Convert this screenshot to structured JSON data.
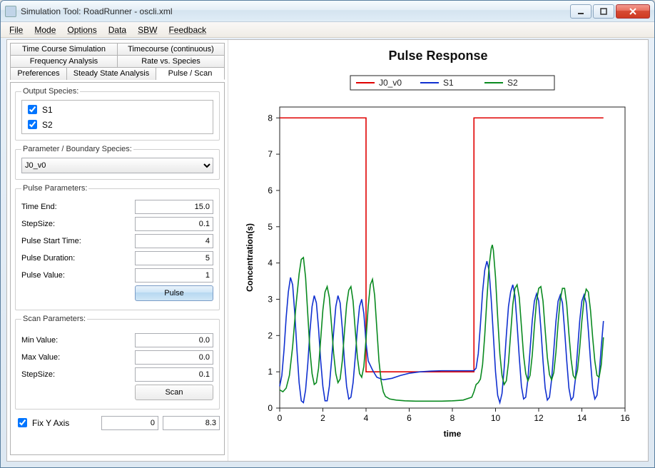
{
  "window": {
    "title": "Simulation Tool: RoadRunner - oscli.xml"
  },
  "menu": {
    "file": "File",
    "mode": "Mode",
    "options": "Options",
    "data": "Data",
    "sbw": "SBW",
    "feedback": "Feedback"
  },
  "tabs": {
    "tcs": "Time Course Simulation",
    "tcc": "Timecourse (continuous)",
    "fa": "Frequency Analysis",
    "rvs": "Rate vs. Species",
    "pref": "Preferences",
    "ssa": "Steady State Analysis",
    "ps": "Pulse / Scan"
  },
  "groups": {
    "output": "Output Species:",
    "param": "Parameter / Boundary Species:",
    "pulse": "Pulse Parameters:",
    "scan": "Scan Parameters:"
  },
  "species": {
    "s1": "S1",
    "s2": "S2"
  },
  "param": {
    "selected": "J0_v0"
  },
  "pulse": {
    "time_end_label": "Time End:",
    "time_end": "15.0",
    "step_label": "StepSize:",
    "step": "0.1",
    "start_label": "Pulse Start Time:",
    "start": "4",
    "dur_label": "Pulse Duration:",
    "dur": "5",
    "val_label": "Pulse Value:",
    "val": "1",
    "btn": "Pulse"
  },
  "scan": {
    "min_label": "Min Value:",
    "min": "0.0",
    "max_label": "Max Value:",
    "max": "0.0",
    "step_label": "StepSize:",
    "step": "0.1",
    "btn": "Scan"
  },
  "fix": {
    "label": "Fix Y Axis",
    "lo": "0",
    "hi": "8.3"
  },
  "chart_data": {
    "type": "line",
    "title": "Pulse Response",
    "xlabel": "time",
    "ylabel": "Concentration(s)",
    "xlim": [
      0,
      16
    ],
    "ylim": [
      0,
      8.3
    ],
    "xticks": [
      0,
      2,
      4,
      6,
      8,
      10,
      12,
      14,
      16
    ],
    "yticks": [
      0,
      1,
      2,
      3,
      4,
      5,
      6,
      7,
      8
    ],
    "series": [
      {
        "name": "J0_v0",
        "color": "#e00000",
        "data": [
          [
            0,
            8
          ],
          [
            4,
            8
          ],
          [
            4,
            1
          ],
          [
            9,
            1
          ],
          [
            9,
            8
          ],
          [
            15,
            8
          ]
        ]
      },
      {
        "name": "S1",
        "color": "#1030d0",
        "data": [
          [
            0.0,
            0.6
          ],
          [
            0.1,
            0.9
          ],
          [
            0.2,
            1.6
          ],
          [
            0.3,
            2.5
          ],
          [
            0.4,
            3.2
          ],
          [
            0.5,
            3.6
          ],
          [
            0.6,
            3.4
          ],
          [
            0.7,
            2.6
          ],
          [
            0.8,
            1.6
          ],
          [
            0.9,
            0.7
          ],
          [
            1.0,
            0.2
          ],
          [
            1.1,
            0.15
          ],
          [
            1.2,
            0.5
          ],
          [
            1.3,
            1.2
          ],
          [
            1.4,
            2.1
          ],
          [
            1.5,
            2.8
          ],
          [
            1.6,
            3.1
          ],
          [
            1.7,
            2.9
          ],
          [
            1.8,
            2.2
          ],
          [
            1.9,
            1.3
          ],
          [
            2.0,
            0.6
          ],
          [
            2.1,
            0.2
          ],
          [
            2.2,
            0.2
          ],
          [
            2.3,
            0.6
          ],
          [
            2.4,
            1.3
          ],
          [
            2.5,
            2.1
          ],
          [
            2.6,
            2.8
          ],
          [
            2.7,
            3.1
          ],
          [
            2.8,
            2.9
          ],
          [
            2.9,
            2.2
          ],
          [
            3.0,
            1.3
          ],
          [
            3.1,
            0.6
          ],
          [
            3.2,
            0.25
          ],
          [
            3.3,
            0.3
          ],
          [
            3.4,
            0.7
          ],
          [
            3.5,
            1.4
          ],
          [
            3.6,
            2.2
          ],
          [
            3.7,
            2.8
          ],
          [
            3.8,
            3.0
          ],
          [
            3.9,
            2.6
          ],
          [
            4.0,
            1.8
          ],
          [
            4.1,
            1.3
          ],
          [
            4.3,
            1.05
          ],
          [
            4.5,
            0.85
          ],
          [
            4.8,
            0.78
          ],
          [
            5.2,
            0.82
          ],
          [
            5.6,
            0.9
          ],
          [
            6.0,
            0.96
          ],
          [
            6.5,
            1.0
          ],
          [
            7.0,
            1.02
          ],
          [
            7.5,
            1.03
          ],
          [
            8.0,
            1.03
          ],
          [
            8.5,
            1.03
          ],
          [
            9.0,
            1.03
          ],
          [
            9.1,
            1.1
          ],
          [
            9.2,
            1.5
          ],
          [
            9.3,
            2.3
          ],
          [
            9.4,
            3.2
          ],
          [
            9.5,
            3.8
          ],
          [
            9.6,
            4.05
          ],
          [
            9.7,
            3.8
          ],
          [
            9.8,
            3.0
          ],
          [
            9.9,
            2.0
          ],
          [
            10.0,
            1.0
          ],
          [
            10.1,
            0.35
          ],
          [
            10.2,
            0.15
          ],
          [
            10.3,
            0.4
          ],
          [
            10.4,
            1.1
          ],
          [
            10.5,
            2.0
          ],
          [
            10.6,
            2.8
          ],
          [
            10.7,
            3.2
          ],
          [
            10.8,
            3.4
          ],
          [
            10.9,
            3.1
          ],
          [
            11.0,
            2.3
          ],
          [
            11.1,
            1.4
          ],
          [
            11.2,
            0.6
          ],
          [
            11.3,
            0.25
          ],
          [
            11.4,
            0.3
          ],
          [
            11.5,
            0.8
          ],
          [
            11.6,
            1.6
          ],
          [
            11.7,
            2.4
          ],
          [
            11.8,
            2.95
          ],
          [
            11.9,
            3.15
          ],
          [
            12.0,
            2.95
          ],
          [
            12.1,
            2.2
          ],
          [
            12.2,
            1.3
          ],
          [
            12.3,
            0.55
          ],
          [
            12.4,
            0.22
          ],
          [
            12.5,
            0.3
          ],
          [
            12.6,
            0.8
          ],
          [
            12.7,
            1.6
          ],
          [
            12.8,
            2.4
          ],
          [
            12.9,
            2.95
          ],
          [
            13.0,
            3.12
          ],
          [
            13.1,
            2.9
          ],
          [
            13.2,
            2.15
          ],
          [
            13.3,
            1.3
          ],
          [
            13.4,
            0.55
          ],
          [
            13.5,
            0.22
          ],
          [
            13.6,
            0.3
          ],
          [
            13.7,
            0.8
          ],
          [
            13.8,
            1.6
          ],
          [
            13.9,
            2.4
          ],
          [
            14.0,
            2.95
          ],
          [
            14.1,
            3.12
          ],
          [
            14.2,
            2.9
          ],
          [
            14.3,
            2.15
          ],
          [
            14.4,
            1.3
          ],
          [
            14.5,
            0.55
          ],
          [
            14.6,
            0.25
          ],
          [
            14.7,
            0.35
          ],
          [
            14.8,
            0.9
          ],
          [
            14.9,
            1.7
          ],
          [
            15.0,
            2.4
          ]
        ]
      },
      {
        "name": "S2",
        "color": "#0a8a20",
        "data": [
          [
            0.0,
            0.5
          ],
          [
            0.15,
            0.45
          ],
          [
            0.3,
            0.55
          ],
          [
            0.45,
            0.9
          ],
          [
            0.6,
            1.7
          ],
          [
            0.75,
            2.8
          ],
          [
            0.9,
            3.7
          ],
          [
            1.0,
            4.1
          ],
          [
            1.1,
            4.15
          ],
          [
            1.2,
            3.6
          ],
          [
            1.3,
            2.6
          ],
          [
            1.4,
            1.6
          ],
          [
            1.5,
            0.95
          ],
          [
            1.6,
            0.65
          ],
          [
            1.7,
            0.7
          ],
          [
            1.8,
            1.1
          ],
          [
            1.9,
            1.9
          ],
          [
            2.0,
            2.7
          ],
          [
            2.1,
            3.2
          ],
          [
            2.2,
            3.35
          ],
          [
            2.3,
            3.05
          ],
          [
            2.4,
            2.3
          ],
          [
            2.5,
            1.5
          ],
          [
            2.6,
            0.95
          ],
          [
            2.7,
            0.7
          ],
          [
            2.8,
            0.8
          ],
          [
            2.9,
            1.3
          ],
          [
            3.0,
            2.1
          ],
          [
            3.1,
            2.85
          ],
          [
            3.2,
            3.25
          ],
          [
            3.3,
            3.35
          ],
          [
            3.4,
            2.95
          ],
          [
            3.5,
            2.15
          ],
          [
            3.6,
            1.4
          ],
          [
            3.7,
            0.95
          ],
          [
            3.8,
            0.85
          ],
          [
            3.9,
            1.15
          ],
          [
            4.0,
            1.9
          ],
          [
            4.1,
            2.8
          ],
          [
            4.2,
            3.4
          ],
          [
            4.3,
            3.55
          ],
          [
            4.4,
            3.1
          ],
          [
            4.5,
            2.2
          ],
          [
            4.6,
            1.3
          ],
          [
            4.7,
            0.75
          ],
          [
            4.8,
            0.45
          ],
          [
            4.9,
            0.32
          ],
          [
            5.1,
            0.25
          ],
          [
            5.4,
            0.22
          ],
          [
            5.8,
            0.2
          ],
          [
            6.3,
            0.19
          ],
          [
            7.0,
            0.19
          ],
          [
            7.5,
            0.19
          ],
          [
            8.0,
            0.2
          ],
          [
            8.5,
            0.22
          ],
          [
            8.9,
            0.3
          ],
          [
            9.0,
            0.45
          ],
          [
            9.1,
            0.65
          ],
          [
            9.2,
            0.7
          ],
          [
            9.3,
            0.8
          ],
          [
            9.4,
            1.2
          ],
          [
            9.5,
            2.0
          ],
          [
            9.6,
            3.0
          ],
          [
            9.7,
            3.9
          ],
          [
            9.8,
            4.4
          ],
          [
            9.85,
            4.5
          ],
          [
            9.9,
            4.35
          ],
          [
            10.0,
            3.6
          ],
          [
            10.1,
            2.5
          ],
          [
            10.2,
            1.5
          ],
          [
            10.3,
            0.9
          ],
          [
            10.4,
            0.65
          ],
          [
            10.5,
            0.75
          ],
          [
            10.6,
            1.25
          ],
          [
            10.7,
            2.05
          ],
          [
            10.8,
            2.85
          ],
          [
            10.9,
            3.3
          ],
          [
            11.0,
            3.4
          ],
          [
            11.1,
            3.05
          ],
          [
            11.2,
            2.25
          ],
          [
            11.3,
            1.45
          ],
          [
            11.4,
            0.95
          ],
          [
            11.5,
            0.75
          ],
          [
            11.6,
            0.9
          ],
          [
            11.7,
            1.45
          ],
          [
            11.8,
            2.25
          ],
          [
            11.9,
            2.95
          ],
          [
            12.0,
            3.3
          ],
          [
            12.1,
            3.35
          ],
          [
            12.2,
            2.95
          ],
          [
            12.3,
            2.15
          ],
          [
            12.4,
            1.4
          ],
          [
            12.5,
            0.92
          ],
          [
            12.6,
            0.78
          ],
          [
            12.7,
            0.98
          ],
          [
            12.8,
            1.55
          ],
          [
            12.9,
            2.35
          ],
          [
            13.0,
            3.0
          ],
          [
            13.1,
            3.3
          ],
          [
            13.2,
            3.3
          ],
          [
            13.3,
            2.85
          ],
          [
            13.4,
            2.05
          ],
          [
            13.5,
            1.35
          ],
          [
            13.6,
            0.9
          ],
          [
            13.7,
            0.8
          ],
          [
            13.8,
            1.05
          ],
          [
            13.9,
            1.65
          ],
          [
            14.0,
            2.4
          ],
          [
            14.1,
            3.0
          ],
          [
            14.2,
            3.28
          ],
          [
            14.3,
            3.2
          ],
          [
            14.4,
            2.7
          ],
          [
            14.5,
            1.95
          ],
          [
            14.6,
            1.3
          ],
          [
            14.7,
            0.9
          ],
          [
            14.8,
            0.85
          ],
          [
            14.9,
            1.2
          ],
          [
            15.0,
            1.95
          ]
        ]
      }
    ]
  }
}
